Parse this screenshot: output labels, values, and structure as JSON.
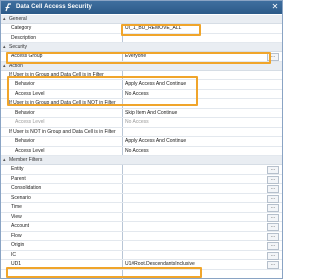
{
  "window": {
    "title": "Data Cell Access Security"
  },
  "colors": {
    "highlight": "#f0a52b",
    "titlebar": "#2c5a88"
  },
  "sections": {
    "general": {
      "label": "General"
    },
    "security": {
      "label": "Security"
    },
    "action": {
      "label": "Action"
    },
    "member_filters": {
      "label": "Member Filters"
    }
  },
  "general": {
    "category_label": "Category",
    "category_value": "UI_1_BU_REMOVE_ALL",
    "description_label": "Description",
    "description_value": ""
  },
  "security": {
    "access_group_label": "Access Group",
    "access_group_value": "Everyone",
    "ellipsis": "..."
  },
  "action": {
    "cond1": "If User is in Group and Data Cell is in Filter",
    "behavior1_label": "Behavior",
    "behavior1_value": "Apply Access And Continue",
    "access1_label": "Access Level",
    "access1_value": "No Access",
    "cond2": "If User is in Group and Data Cell is NOT in Filter",
    "behavior2_label": "Behavior",
    "behavior2_value": "Skip Item And Continue",
    "access2_label": "Access Level",
    "access2_value": "No Access",
    "cond3": "If User is NOT in Group and Data Cell is in Filter",
    "behavior3_label": "Behavior",
    "behavior3_value": "Apply Access And Continue",
    "access3_label": "Access Level",
    "access3_value": "No Access"
  },
  "member_filters": {
    "ellipsis": "...",
    "items": [
      {
        "label": "Entity",
        "value": ""
      },
      {
        "label": "Parent",
        "value": ""
      },
      {
        "label": "Consolidation",
        "value": ""
      },
      {
        "label": "Scenario",
        "value": ""
      },
      {
        "label": "Time",
        "value": ""
      },
      {
        "label": "View",
        "value": ""
      },
      {
        "label": "Account",
        "value": ""
      },
      {
        "label": "Flow",
        "value": ""
      },
      {
        "label": "Origin",
        "value": ""
      },
      {
        "label": "IC",
        "value": ""
      },
      {
        "label": "UD1",
        "value": "U1#Root.DescendantsInclusive"
      }
    ]
  }
}
